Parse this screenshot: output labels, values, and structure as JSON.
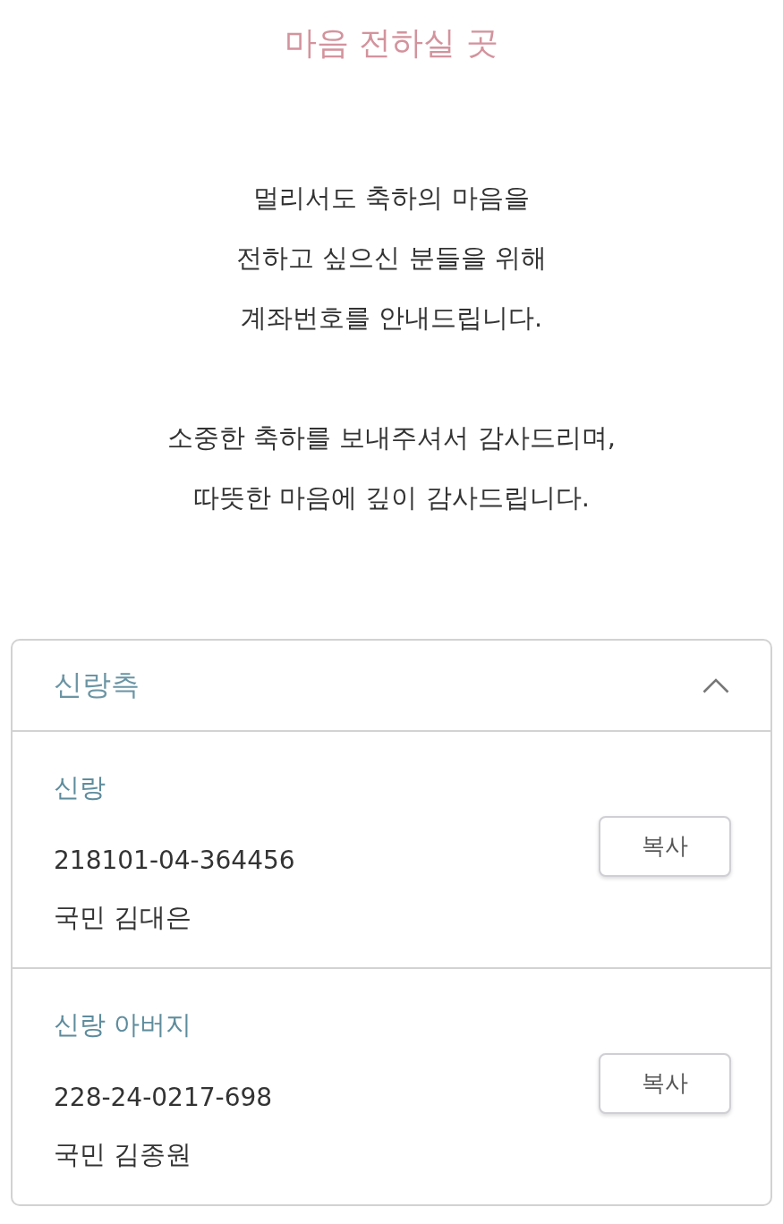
{
  "title": "마음 전하실 곳",
  "message": {
    "paragraphs": [
      [
        "멀리서도 축하의 마음을",
        "전하고 싶으신 분들을 위해",
        "계좌번호를 안내드립니다."
      ],
      [
        "소중한 축하를 보내주셔서 감사드리며,",
        "따뜻한 마음에 깊이 감사드립니다."
      ]
    ]
  },
  "accordion": {
    "title": "신랑측",
    "expanded": true,
    "accounts": [
      {
        "name": "신랑",
        "number": "218101-04-364456",
        "holder": "국민 김대은",
        "button": "복사"
      },
      {
        "name": "신랑 아버지",
        "number": "228-24-0217-698",
        "holder": "국민 김종원",
        "button": "복사"
      }
    ]
  }
}
